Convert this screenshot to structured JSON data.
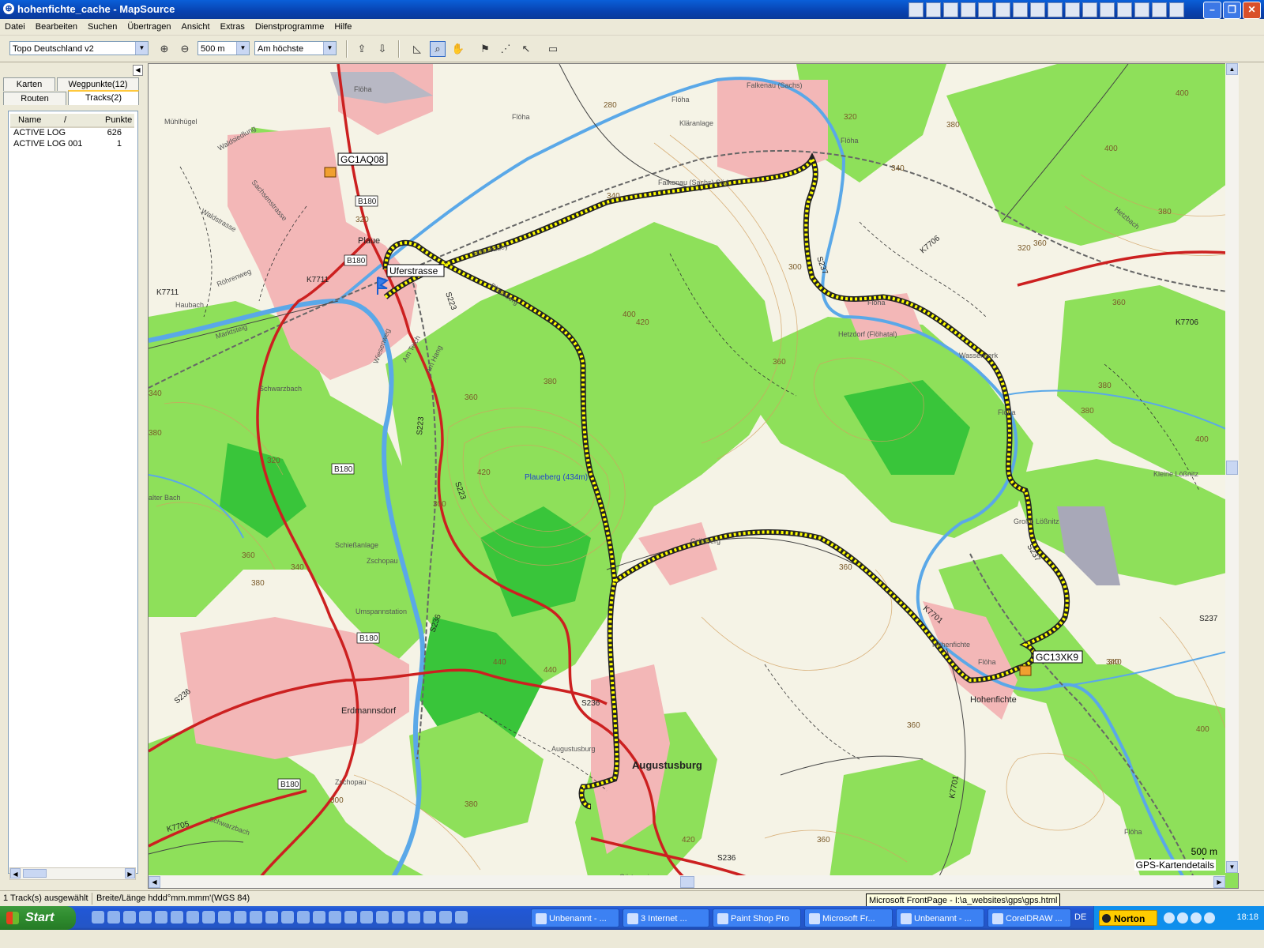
{
  "window": {
    "title": "hohenfichte_cache - MapSource"
  },
  "menu": [
    "Datei",
    "Bearbeiten",
    "Suchen",
    "Übertragen",
    "Ansicht",
    "Extras",
    "Dienstprogramme",
    "Hilfe"
  ],
  "toolbar": {
    "map_product": "Topo Deutschland v2",
    "zoom_scale": "500 m",
    "detail_level": "Am höchste"
  },
  "sidebar": {
    "tabs": {
      "karten": "Karten",
      "wegpunkte": "Wegpunkte(12)",
      "routen": "Routen",
      "tracks": "Tracks(2)"
    },
    "columns": {
      "name": "Name",
      "sort": "/",
      "punkte": "Punkte"
    },
    "tracks": [
      {
        "name": "ACTIVE LOG",
        "points": "626"
      },
      {
        "name": "ACTIVE LOG 001",
        "points": "1"
      }
    ]
  },
  "map": {
    "waypoints": {
      "wp1": "GC1AQ08",
      "wp2": "Uferstrasse",
      "wp3": "GC13XK9"
    },
    "places": {
      "augustusburg": "Augustusburg",
      "hohenfichte": "Hohenfichte",
      "hohenfichte_small": "Hohenfichte",
      "erdmannsdorf": "Erdmannsdorf",
      "plaue": "Plaue",
      "falkenau": "Falkenau (Sachs)",
      "falkenau_sued": "Falkenau (Sachs) Süd",
      "hetzdorf": "Hetzdorf (Flöhatal)",
      "gruenberg": "Grünberg",
      "grosse_loessnitz": "Große Lößnitz",
      "kleine_loessnitz": "Kleine Lößnitz",
      "wasserwerk": "Wasserwerk",
      "klaeranlage": "Kläranlage",
      "schiessanlage": "Schießanlage",
      "zschopau": "Zschopau",
      "zschopau2": "Zschopau",
      "umspannstation": "Umspannstation",
      "schwarzbach": "Schwarzbach",
      "schwarzbach2": "Schwarzbach",
      "schweddey": "Schweddey",
      "plaueberg": "Plaueberg",
      "plaueberg_peak": "Plaueberg (434m)",
      "floeha1": "Flöha",
      "floeha2": "Flöha",
      "floeha3": "Flöha",
      "floeha4": "Flöha",
      "floeha5": "Flöha",
      "floeha6": "Flöha",
      "floeha7": "Flöha",
      "floeha8": "Flöha",
      "gaertnerei": "Gärtnerei",
      "augustusburg_small": "Augustusburg",
      "marktsteig": "Marktsteig",
      "roehrenweg": "Röhrenweg",
      "waldstrasse": "Waldstrasse",
      "waldsiedlung": "Waldsiedlung",
      "sachsenstrasse": "Sachsenstrasse",
      "wiesenweg": "Wiesenweg",
      "am_teich": "Am Teich",
      "am_hang": "Am Hang",
      "haubach": "Haubach",
      "kalter_bach": "alter Bach",
      "muehlhuegel": "Mühlhügel",
      "hetzbach": "Hetzbach"
    },
    "roads": {
      "b180a": "B180",
      "b180b": "B180",
      "b180c": "B180",
      "b180d": "B180",
      "b180e": "B180",
      "s223a": "S223",
      "s223b": "S223",
      "s223c": "S223",
      "s236a": "S236",
      "s236b": "S236",
      "s236c": "S236",
      "s236d": "S236",
      "s237a": "S237",
      "s237b": "S237",
      "s237c": "S237",
      "k7711a": "K7711",
      "k7711b": "K7711",
      "k7706a": "K7706",
      "k7706b": "K7706",
      "k7701a": "K7701",
      "k7701b": "K7701",
      "k7705": "K7705"
    },
    "contours": {
      "c1": "400",
      "c2": "380",
      "c3": "360",
      "c4": "340",
      "c5": "320",
      "c6": "300",
      "c7": "420",
      "c8": "440",
      "c9": "280",
      "c10": "380",
      "c11": "360",
      "c12": "400",
      "c13": "340",
      "c14": "320",
      "c15": "360",
      "c16": "380",
      "c17": "400",
      "c18": "420",
      "c19": "360",
      "c20": "340",
      "c21": "380",
      "c22": "300",
      "c23": "320",
      "c24": "340",
      "c25": "380",
      "c26": "400",
      "c27": "360",
      "c28": "380",
      "c29": "420",
      "c30": "380",
      "c31": "360",
      "c32": "340",
      "c33": "320",
      "c34": "300",
      "c35": "440",
      "c36": "400",
      "c37": "380",
      "c38": "360",
      "c39": "360",
      "c40": "340"
    },
    "scale_label": "500 m",
    "details_label": "GPS-Kartendetails"
  },
  "status": {
    "tracks_selected": "1 Track(s) ausgewählt",
    "coord_format": "Breite/Länge hddd°mm.mmm'(WGS 84)",
    "tooltip": "Microsoft FrontPage - I:\\a_websites\\gps\\gps.html"
  },
  "taskbar": {
    "start": "Start",
    "buttons": [
      "Unbenannt - ...",
      "3 Internet ...",
      "Paint Shop Pro",
      "Microsoft Fr...",
      "Unbenannt - ...",
      "CorelDRAW ..."
    ],
    "lang": "DE",
    "norton": "Norton",
    "clock": "18:18"
  },
  "colors": {
    "forest": "#8ee05a",
    "forest_dark": "#39c53a",
    "open_land": "#f5f3e6",
    "urban": "#f3b7b7",
    "river": "#5aa8e8",
    "main_road": "#cc2020",
    "track": "#ffff00",
    "contour": "#d2a060"
  }
}
